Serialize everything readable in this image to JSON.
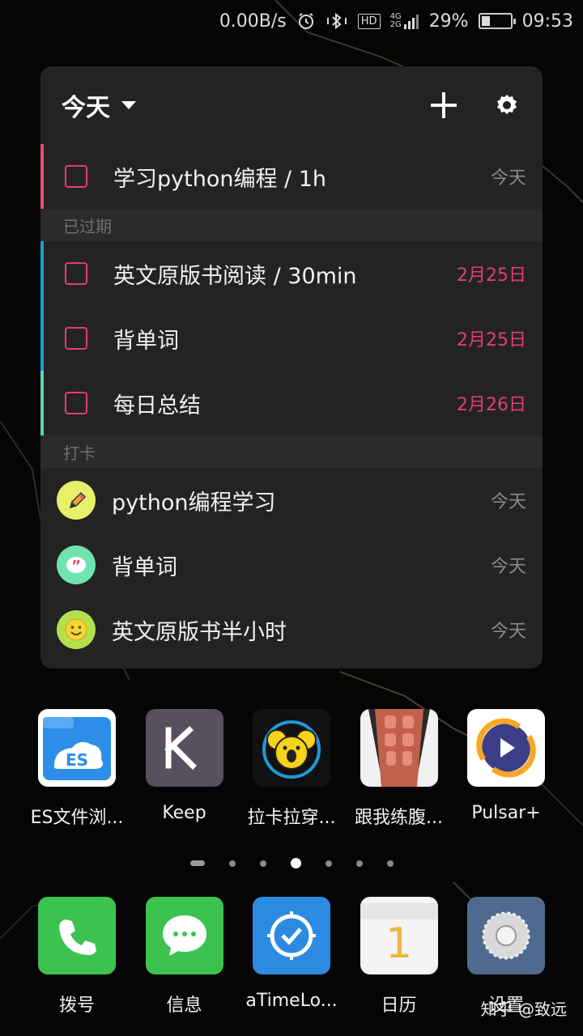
{
  "status_bar": {
    "speed": "0.00B/s",
    "hd": "HD",
    "net_top": "4G",
    "net_bottom": "2G",
    "battery": "29%",
    "battery_level": 0.29,
    "time": "09:53"
  },
  "widget": {
    "title": "今天",
    "today_tasks": [
      {
        "title": "学习python编程 / 1h",
        "date": "今天",
        "accent": "#e5506b"
      }
    ],
    "overdue_header": "已过期",
    "overdue_tasks": [
      {
        "title": "英文原版书阅读 / 30min",
        "date": "2月25日",
        "accent": "#1da1c9"
      },
      {
        "title": "背单词",
        "date": "2月25日",
        "accent": "#1da1c9"
      },
      {
        "title": "每日总结",
        "date": "2月26日",
        "accent": "#5fd6b0"
      }
    ],
    "habits_header": "打卡",
    "habits": [
      {
        "title": "python编程学习",
        "date": "今天",
        "icon": "pencil-icon",
        "color": "#e8f06a"
      },
      {
        "title": "背单词",
        "date": "今天",
        "icon": "quote-icon",
        "color": "#6fe3b0"
      },
      {
        "title": "英文原版书半小时",
        "date": "今天",
        "icon": "smiley-icon",
        "color": "#b5e04d"
      }
    ]
  },
  "apps": [
    {
      "label": "ES文件浏...",
      "icon": "es-file-explorer-icon"
    },
    {
      "label": "Keep",
      "icon": "keep-icon"
    },
    {
      "label": "拉卡拉穿...",
      "icon": "lakala-koala-icon"
    },
    {
      "label": "跟我练腹...",
      "icon": "abs-workout-icon"
    },
    {
      "label": "Pulsar+",
      "icon": "pulsar-play-icon"
    }
  ],
  "dock": [
    {
      "label": "拨号",
      "icon": "phone-icon"
    },
    {
      "label": "信息",
      "icon": "message-icon"
    },
    {
      "label": "aTimeLo...",
      "icon": "atimelogger-icon"
    },
    {
      "label": "日历",
      "icon": "calendar-icon",
      "day": "1"
    },
    {
      "label": "设置",
      "icon": "settings-icon"
    }
  ],
  "watermark": "知乎 @致远",
  "colors": {
    "accent_pink": "#e53d6f",
    "widget_bg": "#232323"
  }
}
